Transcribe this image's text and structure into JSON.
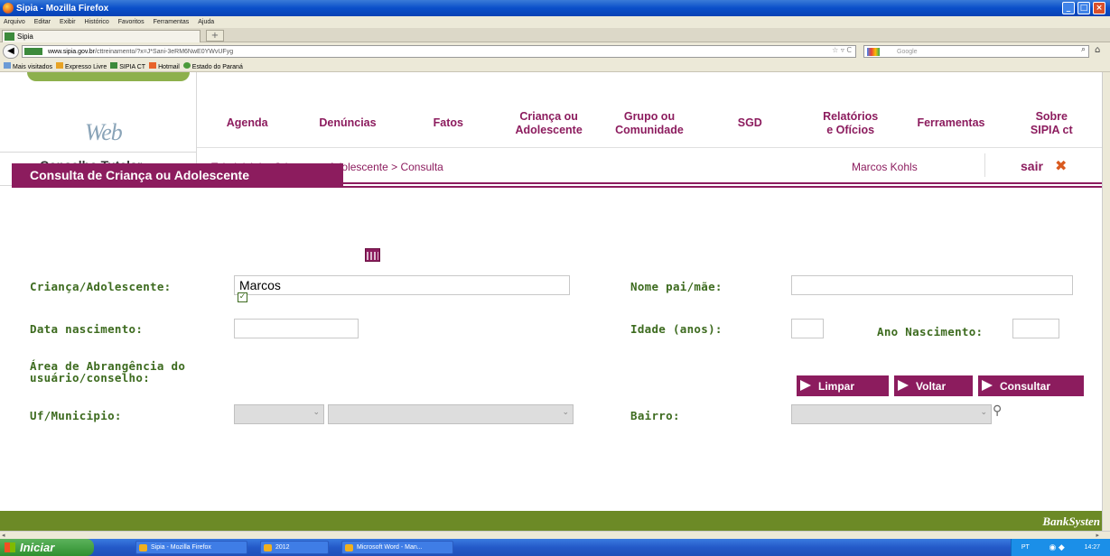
{
  "browser": {
    "title": "Sipia - Mozilla Firefox",
    "menu": [
      "Arquivo",
      "Editar",
      "Exibir",
      "Histórico",
      "Favoritos",
      "Ferramentas",
      "Ajuda"
    ],
    "tab_label": "Sipia",
    "url_host": "www.sipia.gov.br",
    "url_path": "/cttreinamento/?x=J*Sani-3eRM6NwE0YWvUFyg",
    "search_placeholder": "Google",
    "bookmarks": [
      "Mais visitados",
      "Expresso Livre",
      "SIPIA CT",
      "Hotmail",
      "Estado do Paraná"
    ]
  },
  "logo": {
    "web": "Web",
    "conselho": "Conselho Tutelar"
  },
  "nav": [
    "Agenda",
    "Denúncias",
    "Fatos",
    "Criança ou\nAdolescente",
    "Grupo ou\nComunidade",
    "SGD",
    "Relatórios\ne Ofícios",
    "Ferramentas",
    "Sobre\nSIPIA ct"
  ],
  "breadcrumb": "Tela inicial > Criança ou Adolescente > Consulta",
  "user": "Marcos Kohls",
  "logout": "sair",
  "form": {
    "title": "Consulta de Criança ou Adolescente",
    "crianca_label": "Criança/Adolescente:",
    "crianca_value": "Marcos",
    "pai_mae_label": "Nome pai/mãe:",
    "data_nasc_label": "Data nascimento:",
    "idade_label": "Idade (anos):",
    "ano_nasc_label": "Ano Nascimento:",
    "area_label_1": "Área de Abrangência do",
    "area_label_2": "usuário/conselho:",
    "area_checked": true,
    "uf_label": "Uf/Municipio:",
    "bairro_label": "Bairro:",
    "buttons": {
      "limpar": "Limpar",
      "voltar": "Voltar",
      "consultar": "Consultar"
    }
  },
  "footer_brand": "BankSysten",
  "taskbar": {
    "start": "Iniciar",
    "tasks": [
      "Sipia - Mozilla Firefox",
      "2012",
      "Microsoft Word - Man..."
    ],
    "lang": "PT",
    "clock": "14:27"
  },
  "colors": {
    "accent": "#8c1c5e",
    "label_green": "#3d6b1f",
    "footer_green": "#6c8a26"
  }
}
